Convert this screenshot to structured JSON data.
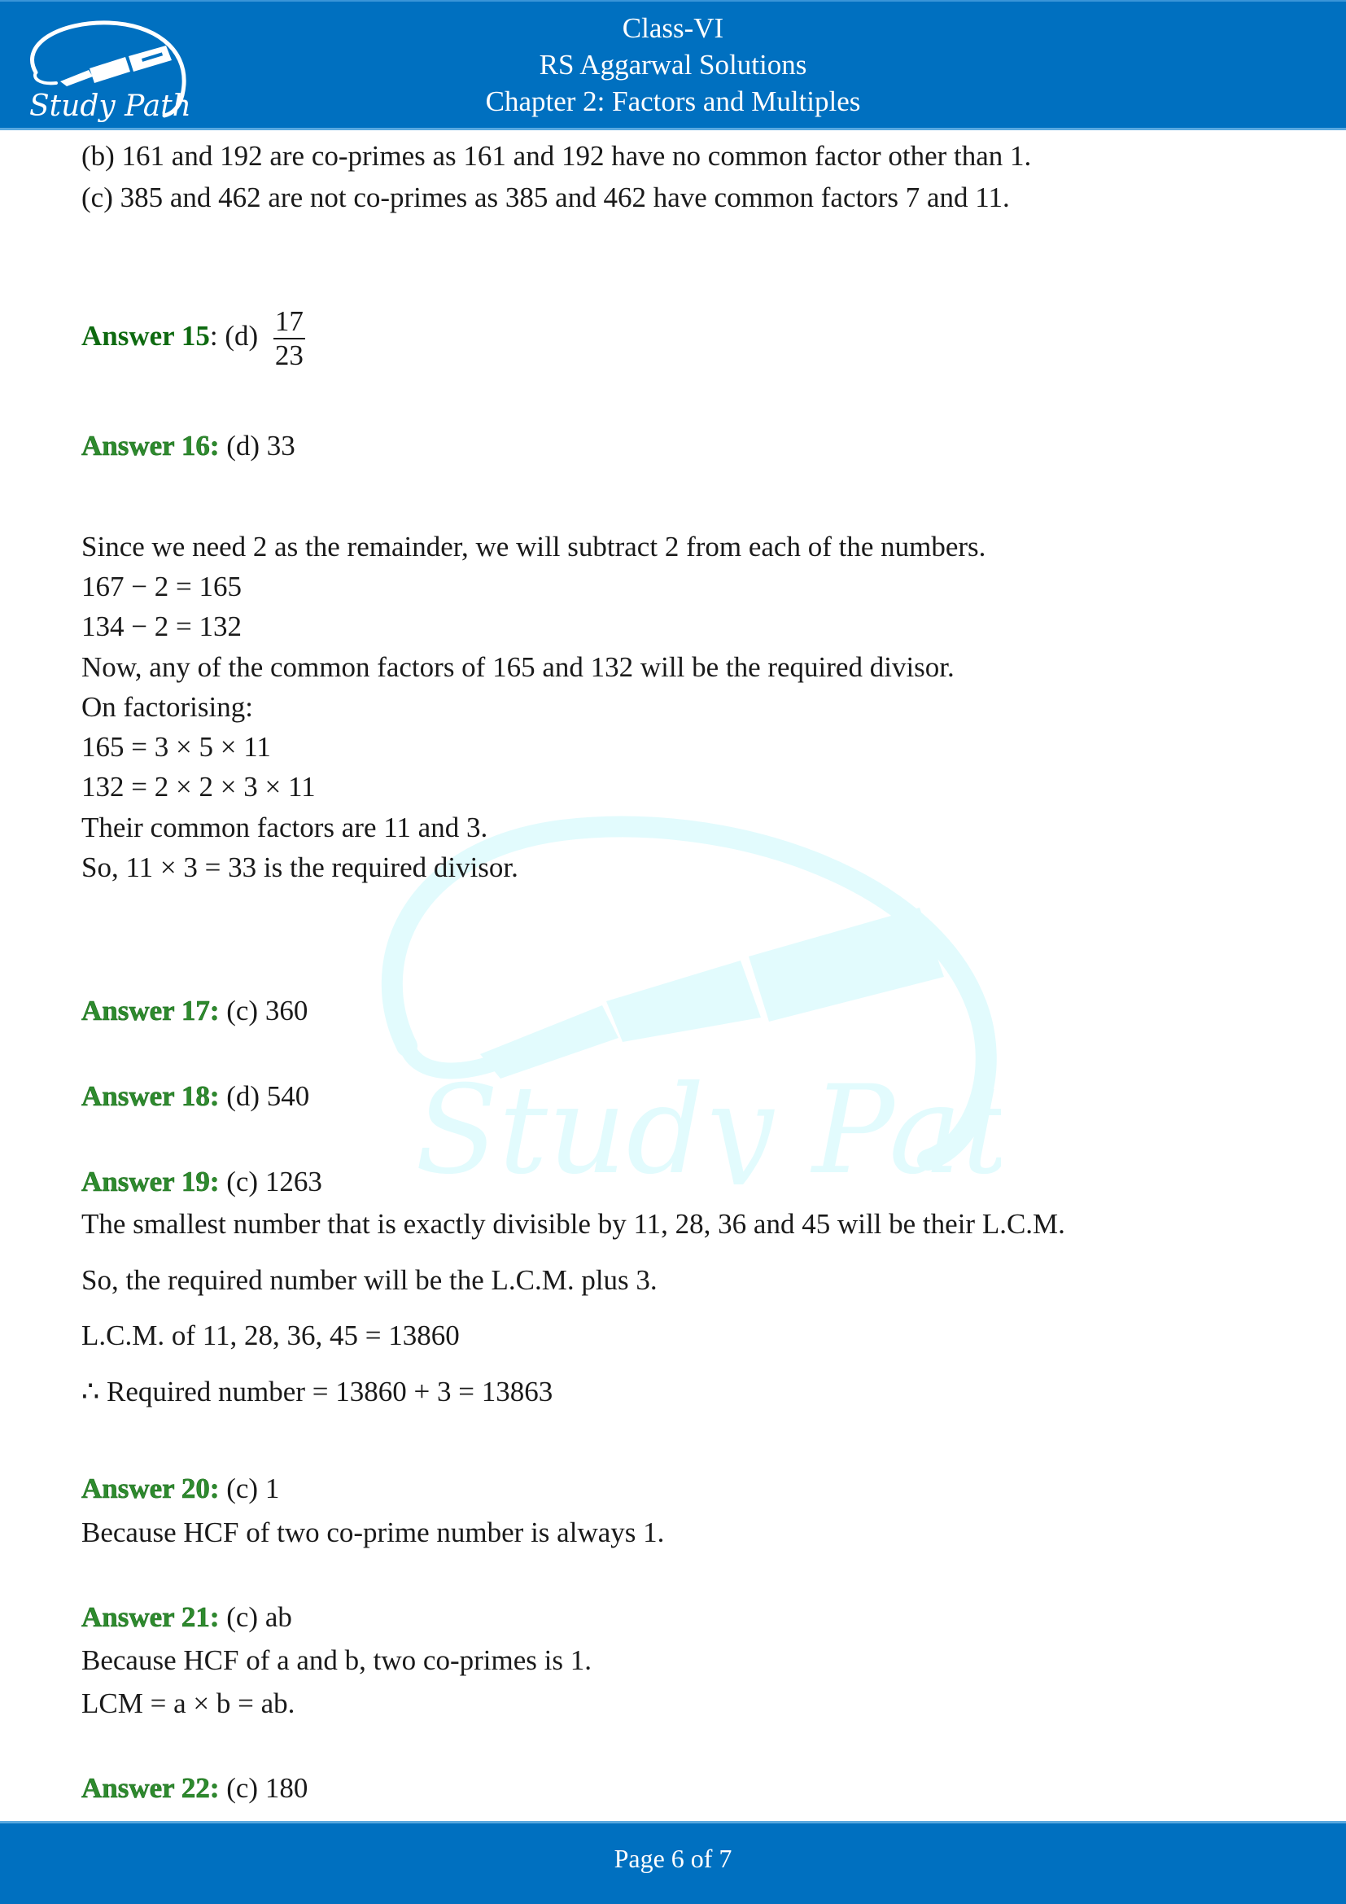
{
  "header": {
    "logo_text": "Study Path",
    "class_label": "Class-VI",
    "book_title": "RS Aggarwal Solutions",
    "chapter_title": "Chapter 2: Factors and Multiples"
  },
  "colors": {
    "brand_blue": "#0070c0",
    "answer_green": "#1b7a1b",
    "watermark_cyan": "#e2fbfd"
  },
  "content": {
    "continuation": [
      "(b) 161 and 192 are co-primes as 161 and 192 have no common factor other than 1.",
      " (c) 385 and 462 are not co-primes as 385 and 462 have common factors 7 and 11."
    ],
    "answer15": {
      "label": "Answer 15",
      "sep": ":",
      "option": " (d)",
      "numerator": "17",
      "denominator": "23"
    },
    "answer16": {
      "label": "Answer 16:",
      "value": " (d) 33",
      "explanation": [
        "Since we need 2 as the remainder, we will subtract 2 from each of the numbers.",
        "167 − 2 = 165",
        "134 − 2 = 132",
        "Now, any of the common factors of 165 and 132 will be the required divisor.",
        "On factorising:",
        "165 =  3 × 5 × 11",
        "132 = 2 × 2 × 3 × 11",
        "Their common factors are 11 and 3.",
        "So, 11 × 3 = 33 is the required divisor."
      ]
    },
    "answer17": {
      "label": "Answer 17:",
      "value": " (c) 360"
    },
    "answer18": {
      "label": "Answer 18:",
      "value": " (d) 540"
    },
    "answer19": {
      "label": "Answer 19:",
      "value": " (c) 1263",
      "explanation": [
        "The smallest number that is exactly divisible by 11, 28, 36 and 45 will be their L.C.M.",
        "So, the required number will be the L.C.M. plus 3.",
        "L.C.M. of 11, 28, 36, 45 = 13860",
        "∴ Required number = 13860 + 3 = 13863"
      ]
    },
    "answer20": {
      "label": "Answer 20:",
      "value": " (c) 1",
      "explanation": [
        "Because HCF of two co-prime number is always 1."
      ]
    },
    "answer21": {
      "label": "Answer 21:",
      "value": " (c) ab",
      "explanation": [
        "Because HCF of a and b, two co-primes is 1.",
        "LCM = a × b = ab."
      ]
    },
    "answer22": {
      "label": "Answer 22:",
      "value": " (c) 180"
    }
  },
  "footer": {
    "page_label": "Page 6 of 7"
  }
}
